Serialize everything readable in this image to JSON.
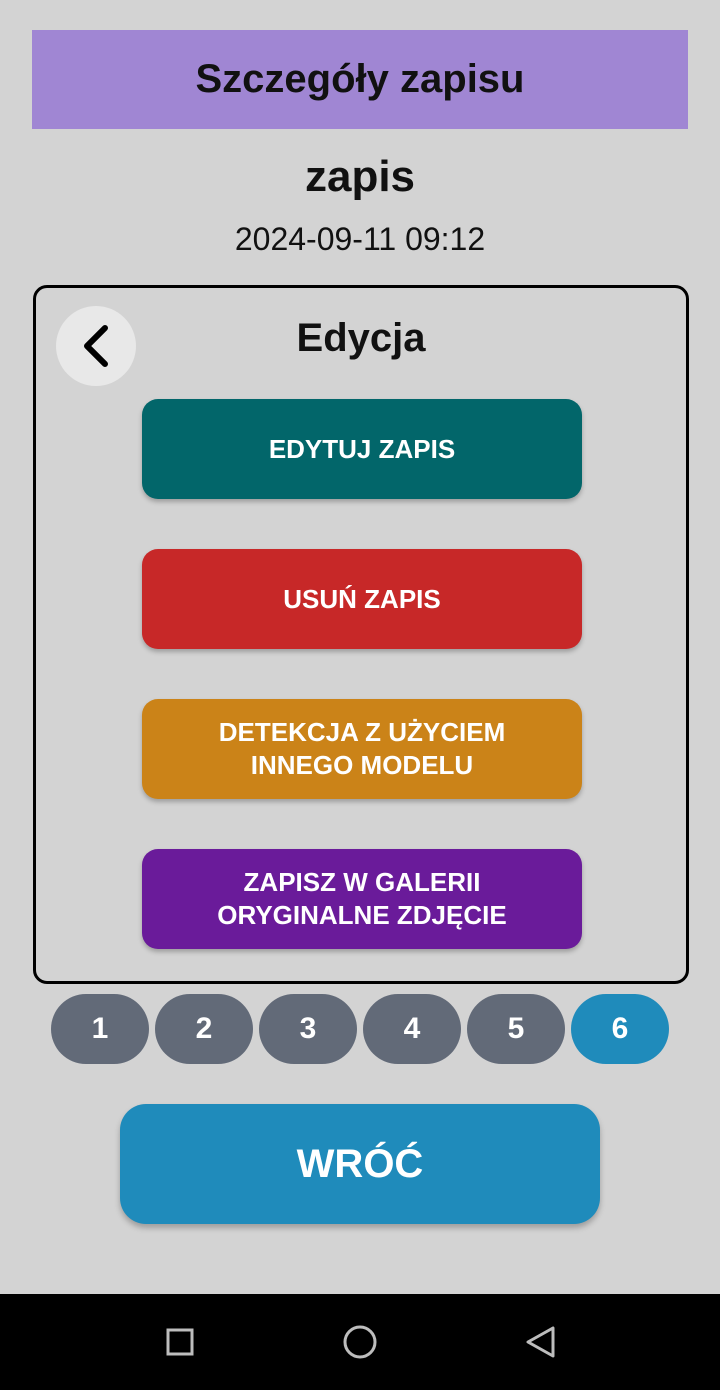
{
  "header": {
    "title": "Szczegóły zapisu"
  },
  "record": {
    "name": "zapis",
    "date": "2024-09-11 09:12"
  },
  "panel": {
    "title": "Edycja",
    "back_icon": "chevron-left-icon",
    "buttons": [
      {
        "label": "EDYTUJ ZAPIS",
        "color": "#02666a"
      },
      {
        "label": "USUŃ ZAPIS",
        "color": "#c72828"
      },
      {
        "label": "DETEKCJA Z UŻYCIEM\nINNEGO MODELU",
        "color": "#cb8318"
      },
      {
        "label": "ZAPISZ W GALERII\nORYGINALNE ZDJĘCIE",
        "color": "#6a1b9a"
      }
    ]
  },
  "pager": {
    "pages": [
      "1",
      "2",
      "3",
      "4",
      "5",
      "6"
    ],
    "active": "6",
    "inactive_color": "#626a78",
    "active_color": "#1f8bbb"
  },
  "back_button": {
    "label": "WRÓĆ"
  },
  "nav_bar": {
    "icons": [
      "square-recents-icon",
      "circle-home-icon",
      "triangle-back-icon"
    ]
  }
}
